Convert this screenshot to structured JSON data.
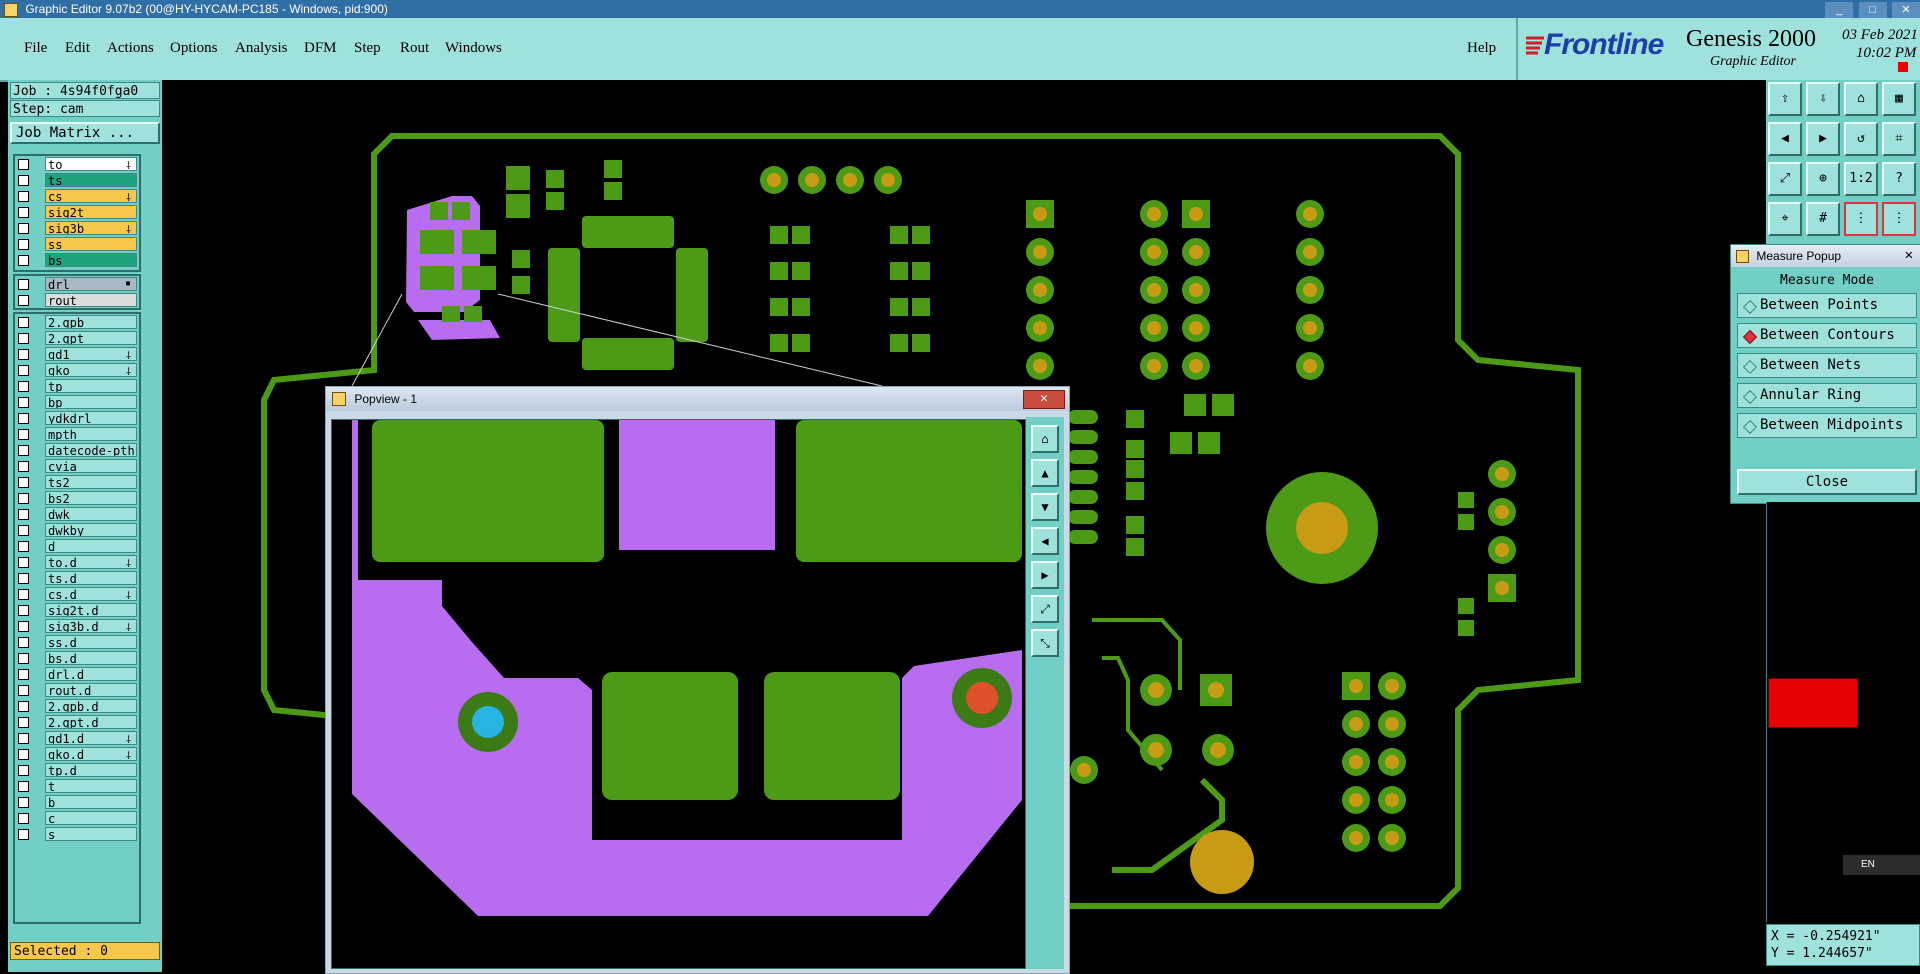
{
  "window": {
    "title": "Graphic Editor 9.07b2 (00@HY-HYCAM-PC185 - Windows, pid:900)"
  },
  "menu": {
    "file": "File",
    "edit": "Edit",
    "actions": "Actions",
    "options": "Options",
    "analysis": "Analysis",
    "dfm": "DFM",
    "step": "Step",
    "rout": "Rout",
    "windows": "Windows",
    "help": "Help"
  },
  "brand": {
    "logo": "Frontline",
    "product": "Genesis 2000",
    "subtitle": "Graphic Editor",
    "date": "03 Feb 2021",
    "time": "10:02 PM"
  },
  "job": {
    "job_line": "Job : 4s94f0fga0",
    "step_line": "Step: cam",
    "matrix_button": "Job Matrix ..."
  },
  "layers_top": [
    {
      "name": "to",
      "color": "#ffffff",
      "mark": "⸸"
    },
    {
      "name": "ts",
      "color": "#1fa37e",
      "mark": ""
    },
    {
      "name": "cs",
      "color": "#f6c84a",
      "mark": "⸸"
    },
    {
      "name": "sig2t",
      "color": "#f6c84a",
      "mark": ""
    },
    {
      "name": "sig3b",
      "color": "#f6c84a",
      "mark": "⸸"
    },
    {
      "name": "ss",
      "color": "#f6c84a",
      "mark": ""
    },
    {
      "name": "bs",
      "color": "#1fa37e",
      "mark": ""
    }
  ],
  "layers_drill": [
    {
      "name": "drl",
      "color": "#aab8c4",
      "mark": "▪"
    },
    {
      "name": "rout",
      "color": "#dcdcdc",
      "mark": ""
    }
  ],
  "layers_misc": [
    {
      "name": "2.gpb",
      "mark": ""
    },
    {
      "name": "2.gpt",
      "mark": ""
    },
    {
      "name": "gd1",
      "mark": "⸸"
    },
    {
      "name": "gko",
      "mark": "⸸"
    },
    {
      "name": "tp",
      "mark": ""
    },
    {
      "name": "bp",
      "mark": ""
    },
    {
      "name": "ydkdrl",
      "mark": ""
    },
    {
      "name": "mpth",
      "mark": ""
    },
    {
      "name": "datecode-pth",
      "mark": ""
    },
    {
      "name": "cvia",
      "mark": ""
    },
    {
      "name": "ts2",
      "mark": ""
    },
    {
      "name": "bs2",
      "mark": ""
    },
    {
      "name": "dwk",
      "mark": ""
    },
    {
      "name": "dwkby",
      "mark": ""
    },
    {
      "name": "d",
      "mark": ""
    },
    {
      "name": "to.d",
      "mark": "⸸"
    },
    {
      "name": "ts.d",
      "mark": ""
    },
    {
      "name": "cs.d",
      "mark": "⸸"
    },
    {
      "name": "sig2t.d",
      "mark": ""
    },
    {
      "name": "sig3b.d",
      "mark": "⸸"
    },
    {
      "name": "ss.d",
      "mark": ""
    },
    {
      "name": "bs.d",
      "mark": ""
    },
    {
      "name": "drl.d",
      "mark": ""
    },
    {
      "name": "rout.d",
      "mark": ""
    },
    {
      "name": "2.gpb.d",
      "mark": ""
    },
    {
      "name": "2.gpt.d",
      "mark": ""
    },
    {
      "name": "gd1.d",
      "mark": "⸸"
    },
    {
      "name": "gko.d",
      "mark": "⸸"
    },
    {
      "name": "tp.d",
      "mark": ""
    },
    {
      "name": "t",
      "mark": ""
    },
    {
      "name": "b",
      "mark": ""
    },
    {
      "name": "c",
      "mark": ""
    },
    {
      "name": "s",
      "mark": ""
    }
  ],
  "status": {
    "selected": "Selected : 0"
  },
  "popview": {
    "title": "Popview - 1",
    "close": "✕"
  },
  "measure": {
    "title": "Measure Popup",
    "mode_label": "Measure Mode",
    "options": [
      {
        "label": "Between Points",
        "selected": false
      },
      {
        "label": "Between Contours",
        "selected": true
      },
      {
        "label": "Between Nets",
        "selected": false
      },
      {
        "label": "Annular Ring",
        "selected": false
      },
      {
        "label": "Between Midpoints",
        "selected": false
      }
    ],
    "close": "Close"
  },
  "toolbar": {
    "scale_label": "1:2",
    "help_label": "?"
  },
  "lang": {
    "label": "EN"
  },
  "coords": {
    "x": "X = -0.254921\"",
    "y": "Y = 1.244657\""
  },
  "colors": {
    "teal": "#72cfc6",
    "teal_light": "#9fe1db",
    "pcb_green": "#4c9a16",
    "pad_gold": "#c89b14",
    "purple": "#b86cf0",
    "canvas": "#000000"
  }
}
